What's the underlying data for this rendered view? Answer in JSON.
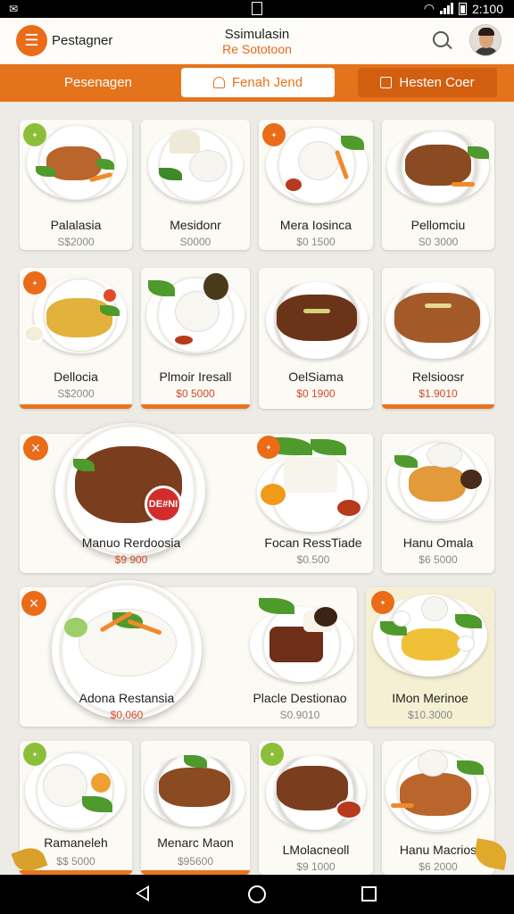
{
  "status_bar": {
    "left_icon": "email-icon",
    "center_icon": "phone-icon",
    "time": "2:100"
  },
  "header": {
    "app_name": "Pestagner",
    "title": "Ssimulasin",
    "subtitle": "Re Sototoon"
  },
  "tabs": [
    {
      "label": "Pesenagen"
    },
    {
      "label": "Fenah Jend"
    },
    {
      "label": "Hesten Coer"
    }
  ],
  "menu": [
    {
      "name": "Palalasia",
      "price": "S$2000"
    },
    {
      "name": "Mesidonr",
      "price": "S0000"
    },
    {
      "name": "Mera Iosinca",
      "price": "$0 1500"
    },
    {
      "name": "Pellomciu",
      "price": "S0 3000"
    },
    {
      "name": "Dellocia",
      "price": "S$2000"
    },
    {
      "name": "Plmoir Iresall",
      "price": "$0 5000"
    },
    {
      "name": "OelSiama",
      "price": "$0 1900"
    },
    {
      "name": "Relsioosr",
      "price": "$1.9010"
    },
    {
      "name": "Manuo Rerdoosia",
      "price": "$9 900",
      "sticker": "DE#NI"
    },
    {
      "name": "Focan RessTiade",
      "price": "$0.500"
    },
    {
      "name": "Hanu Omala",
      "price": "$6 5000"
    },
    {
      "name": "Adona Restansia",
      "price": "$0,060"
    },
    {
      "name": "Placle Destionao",
      "price": "S0.9010"
    },
    {
      "name": "IMon Merinoe",
      "price": "$10.3000"
    },
    {
      "name": "Ramaneleh",
      "price": "$$ 5000"
    },
    {
      "name": "Menarc Maon",
      "price": "$95600"
    },
    {
      "name": "LMolacneoll",
      "price": "$9 1000"
    },
    {
      "name": "Hanu Macrios",
      "price": "$6 2000"
    }
  ],
  "colors": {
    "accent": "#e4731c",
    "header_bg": "#fdfcf9",
    "page_bg": "#ecebe6",
    "price_red": "#d24a2a"
  },
  "icons": [
    "menu-icon",
    "search-icon",
    "user-icon",
    "alert-icon",
    "close-icon",
    "back-icon",
    "home-icon",
    "recent-apps-icon"
  ]
}
